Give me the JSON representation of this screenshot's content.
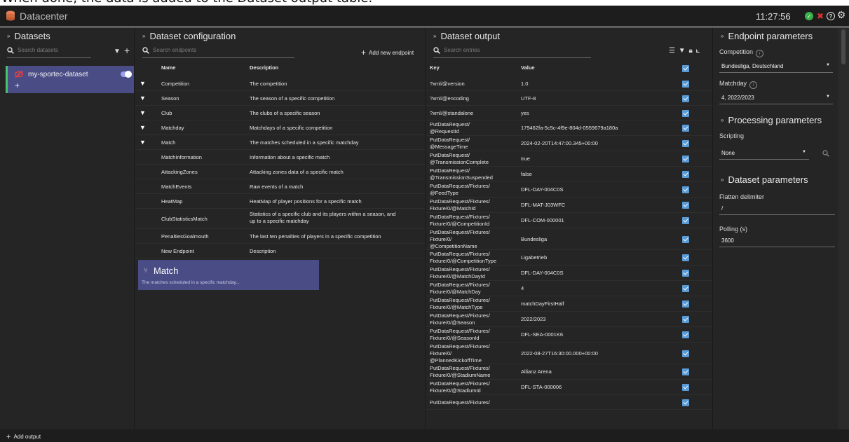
{
  "caption": "When done, the data is added to the Dataset output table.",
  "app": {
    "title": "Datacenter",
    "clock": "11:27:56"
  },
  "datasets": {
    "header": "Datasets",
    "search_placeholder": "Search datasets",
    "items": [
      {
        "name": "my-sportec-dataset"
      }
    ]
  },
  "config": {
    "header": "Dataset configuration",
    "search_placeholder": "Search endpoints",
    "add_label": "Add new endpoint",
    "columns": [
      "Name",
      "Description"
    ],
    "rows": [
      {
        "name": "Competition",
        "desc": "The competition",
        "filter": true
      },
      {
        "name": "Season",
        "desc": "The season of a specific competition",
        "filter": true
      },
      {
        "name": "Club",
        "desc": "The clubs of a specific season",
        "filter": true
      },
      {
        "name": "Matchday",
        "desc": "Matchdays of a specific competition",
        "filter": true
      },
      {
        "name": "Match",
        "desc": "The matches scheduled in a specific matchday",
        "filter": true
      },
      {
        "name": "MatchInformation",
        "desc": "Information about a specific match",
        "filter": false
      },
      {
        "name": "AttackingZones",
        "desc": "Attacking zones data of a specific match",
        "filter": false
      },
      {
        "name": "MatchEvents",
        "desc": "Raw events of a match",
        "filter": false
      },
      {
        "name": "HeatMap",
        "desc": "HeatMap of player positions for a specific match",
        "filter": false
      },
      {
        "name": "ClubStatisticsMatch",
        "desc": "Statistics of a specific club and its players within a season, and up to a specific matchday",
        "filter": false
      },
      {
        "name": "PenaltiesGoalmouth",
        "desc": "The last ten penalties of players in a specific competition",
        "filter": false
      },
      {
        "name": "New Endpoint",
        "desc": "Description",
        "filter": false
      }
    ],
    "selected": {
      "title": "Match",
      "desc": "The matches scheduled in a specific matchday..."
    }
  },
  "output": {
    "header": "Dataset output",
    "search_placeholder": "Search entries",
    "columns": [
      "Key",
      "Value"
    ],
    "rows": [
      {
        "key": "?xml/@version",
        "value": "1.0"
      },
      {
        "key": "?xml/@encoding",
        "value": "UTF-8"
      },
      {
        "key": "?xml/@standalone",
        "value": "yes"
      },
      {
        "key": "PutDataRequest/\n@RequestId",
        "value": "179462fa-5c5c-4f9e-804d-0559679a180a"
      },
      {
        "key": "PutDataRequest/\n@MessageTime",
        "value": "2024-02-20T14:47:00.345+00:00"
      },
      {
        "key": "PutDataRequest/\n@TransmissionComplete",
        "value": "true"
      },
      {
        "key": "PutDataRequest/\n@TransmissionSuspended",
        "value": "false"
      },
      {
        "key": "PutDataRequest/Fixtures/\n@FeedType",
        "value": "DFL-DAY-004C0S"
      },
      {
        "key": "PutDataRequest/Fixtures/\nFixture/0/@MatchId",
        "value": "DFL-MAT-J03WFC"
      },
      {
        "key": "PutDataRequest/Fixtures/\nFixture/0/@CompetitionId",
        "value": "DFL-COM-000001"
      },
      {
        "key": "PutDataRequest/Fixtures/\nFixture/0/\n@CompetitionName",
        "value": "Bundesliga"
      },
      {
        "key": "PutDataRequest/Fixtures/\nFixture/0/@CompetitionType",
        "value": "Ligabetrieb"
      },
      {
        "key": "PutDataRequest/Fixtures/\nFixture/0/@MatchDayId",
        "value": "DFL-DAY-004C0S"
      },
      {
        "key": "PutDataRequest/Fixtures/\nFixture/0/@MatchDay",
        "value": "4"
      },
      {
        "key": "PutDataRequest/Fixtures/\nFixture/0/@MatchType",
        "value": "matchDayFirstHalf"
      },
      {
        "key": "PutDataRequest/Fixtures/\nFixture/0/@Season",
        "value": "2022/2023"
      },
      {
        "key": "PutDataRequest/Fixtures/\nFixture/0/@SeasonId",
        "value": "DFL-SEA-0001K6"
      },
      {
        "key": "PutDataRequest/Fixtures/\nFixture/0/\n@PlannedKickoffTime",
        "value": "2022-08-27T16:30:00.000+00:00"
      },
      {
        "key": "PutDataRequest/Fixtures/\nFixture/0/@StadiumName",
        "value": "Allianz Arena"
      },
      {
        "key": "PutDataRequest/Fixtures/\nFixture/0/@StadiumId",
        "value": "DFL-STA-000006"
      },
      {
        "key": "PutDataRequest/Fixtures/",
        "value": ""
      }
    ]
  },
  "params": {
    "endpoint_header": "Endpoint parameters",
    "competition_label": "Competition",
    "competition_value": "Bundesliga, Deutschland",
    "matchday_label": "Matchday",
    "matchday_value": "4, 2022/2023",
    "processing_header": "Processing parameters",
    "scripting_label": "Scripting",
    "scripting_value": "None",
    "dataset_header": "Dataset parameters",
    "flatten_label": "Flatten delimiter",
    "flatten_value": "/",
    "polling_label": "Polling (s)",
    "polling_value": "3600"
  },
  "footer": {
    "add_output_label": "Add output"
  },
  "colors": {
    "accent": "#4a4c86",
    "checkbox": "#5b9bd5",
    "ok": "#3bb14a",
    "alert": "#e03131",
    "active_bar": "#46c46c"
  }
}
